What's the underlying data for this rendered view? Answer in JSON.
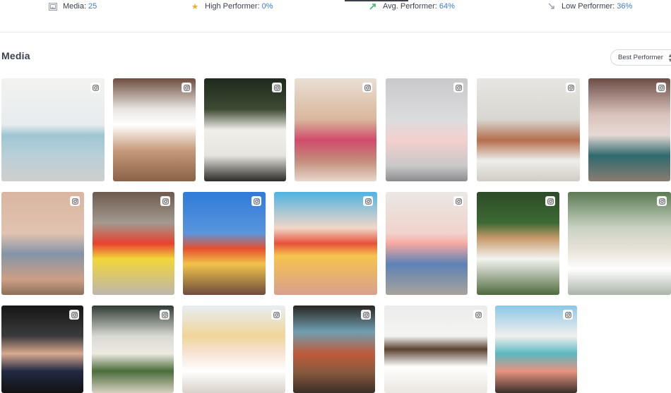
{
  "stats": {
    "media": {
      "label": "Media:",
      "value": "25",
      "icon": "image-icon"
    },
    "high": {
      "label": "High Performer:",
      "value": "0%",
      "icon": "star-icon"
    },
    "avg": {
      "label": "Avg. Performer:",
      "value": "64%",
      "icon": "trend-up-icon"
    },
    "low": {
      "label": "Low Performer:",
      "value": "36%",
      "icon": "trend-down-icon"
    }
  },
  "section": {
    "title": "Media"
  },
  "sort": {
    "selected": "Best Performer"
  },
  "media_tiles": [
    {
      "subject": "vintage-car-tile",
      "bg": "linear-gradient(180deg,#f2f2f0 0%,#e8ecee 45%,#9fc6d3 55%,#b9cfd8 75%,#cfcfcc 100%)"
    },
    {
      "subject": "striped-skirt-tile",
      "bg": "linear-gradient(180deg,#6e4d3e 0%,#e9e6e2 30%,#ffffff 45%,#c69a7a 70%,#8a6247 100%)"
    },
    {
      "subject": "white-dress-tile",
      "bg": "linear-gradient(180deg,#1e2a1c 0%,#3d4a33 30%,#f0efea 50%,#e6e4df 75%,#2a2a26 100%)"
    },
    {
      "subject": "floral-swimsuit-tile",
      "bg": "linear-gradient(180deg,#e9dfd4 0%,#d9b69c 40%,#d14b6a 60%,#c38c7b 80%,#e8d8cc 100%)"
    },
    {
      "subject": "pink-dress-tile",
      "bg": "linear-gradient(180deg,#c9c9cb 0%,#dcdcdf 40%,#f3d0cd 60%,#c9c8c9 85%,#8b8b8d 100%)"
    },
    {
      "subject": "rooftop-dress-tile",
      "bg": "linear-gradient(180deg,#e7e6e2 0%,#d8d6d1 40%,#b46e4c 60%,#eeeeeb 80%,#d1cbc4 100%)"
    },
    {
      "subject": "teal-jumpsuit-tile",
      "bg": "linear-gradient(180deg,#6c4d46 0%,#d9c2bb 35%,#e7d9d5 55%,#2f6a6f 75%,#8a7b70 100%)"
    },
    {
      "subject": "hat-jumpsuit-tile",
      "bg": "linear-gradient(180deg,#d9b6a1 0%,#e1c3b0 40%,#8594a8 60%,#cc9f85 85%,#8c6f5c 100%)"
    },
    {
      "subject": "colorful-dress-tile",
      "bg": "linear-gradient(180deg,#6e5a4e 0%,#a39a90 30%,#e7412f 50%,#f2d63a 65%,#bdb6ad 100%)"
    },
    {
      "subject": "striped-top-sky-tile",
      "bg": "linear-gradient(180deg,#2f7bd8 0%,#5a95dd 40%,#e64f2e 55%,#f2c34a 70%,#6d4c3e 100%)"
    },
    {
      "subject": "rainbow-dress-stairs-tile",
      "bg": "linear-gradient(180deg,#4fb3e2 0%,#f1d7c8 35%,#e7513a 50%,#f5c44e 62%,#d8a08e 100%)"
    },
    {
      "subject": "brick-wall-jeans-tile",
      "bg": "linear-gradient(180deg,#ebe8e4 0%,#f0d3cc 40%,#f6a9a2 50%,#5e82b5 70%,#a8a39c 100%)"
    },
    {
      "subject": "tropical-hat-tile",
      "bg": "linear-gradient(180deg,#2c4a27 0%,#3e6a34 30%,#c79a6b 45%,#f4f4f0 65%,#4f6a3e 100%)"
    },
    {
      "subject": "mural-hat-tile",
      "bg": "linear-gradient(180deg,#5c7a53 0%,#c9d3c4 35%,#e7e1d6 55%,#ffffff 75%,#aab4a8 100%)"
    },
    {
      "subject": "car-door-stripes-tile",
      "bg": "linear-gradient(180deg,#161616 0%,#3b3b3d 35%,#d9a98f 55%,#222a44 75%,#121212 100%)"
    },
    {
      "subject": "porch-flowers-tile",
      "bg": "linear-gradient(180deg,#2f3b33 0%,#d9d9d4 35%,#eeeae2 55%,#4a6d3b 75%,#d8d0c2 100%)"
    },
    {
      "subject": "two-sunhats-tile",
      "bg": "linear-gradient(180deg,#e7eef2 0%,#f0d59a 35%,#f7e4d5 55%,#ffffff 75%,#d8d2c9 100%)"
    },
    {
      "subject": "pool-red-top-tile",
      "bg": "linear-gradient(180deg,#2a2521 0%,#6f9fb0 30%,#c05a3a 55%,#8b5a3f 75%,#3a2f28 100%)"
    },
    {
      "subject": "beach-white-shirt-tile",
      "bg": "linear-gradient(180deg,#ececec 0%,#f4f4f2 35%,#5a4130 50%,#ffffff 70%,#e9e6e0 100%)"
    },
    {
      "subject": "pink-building-tile",
      "bg": "linear-gradient(180deg,#8cc7e6 0%,#f1f0ee 35%,#5bb8c2 55%,#e8937f 75%,#3a2f2a 100%)"
    }
  ]
}
